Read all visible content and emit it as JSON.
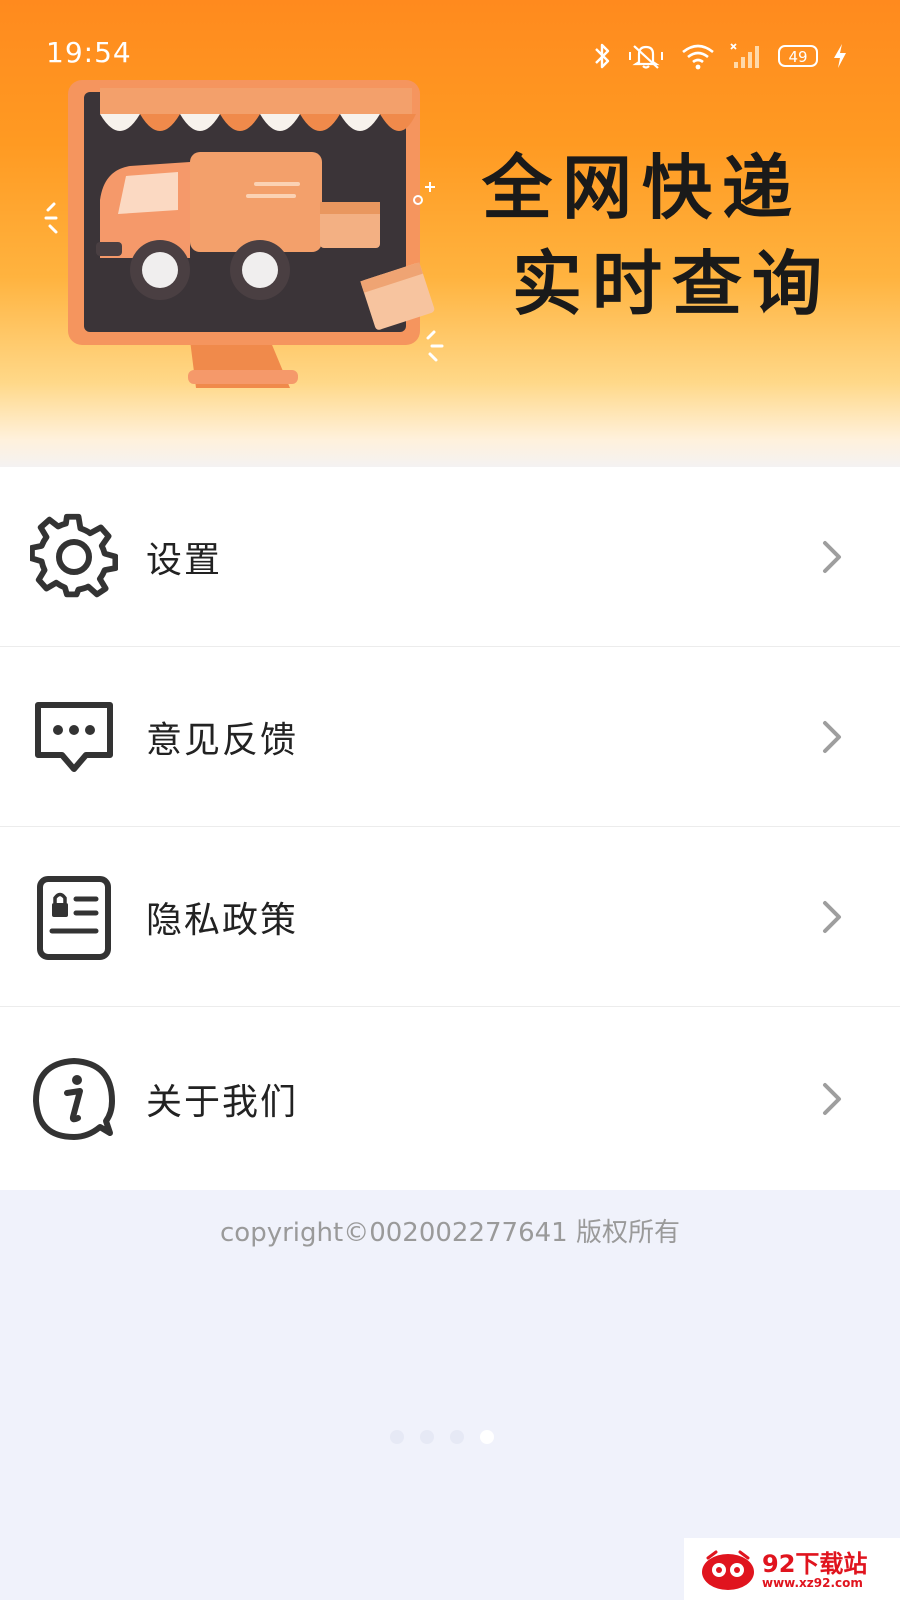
{
  "status_bar": {
    "time": "19:54",
    "battery": "49",
    "icons": [
      "bluetooth-icon",
      "mute-icon",
      "wifi-icon",
      "signal-icon",
      "charging-icon"
    ]
  },
  "banner": {
    "title_line1": "全网快递",
    "title_line2": "实时查询",
    "illustration": "delivery-truck-shop-illustration"
  },
  "menu": {
    "items": [
      {
        "label": "设置",
        "icon": "gear-icon"
      },
      {
        "label": "意见反馈",
        "icon": "feedback-icon"
      },
      {
        "label": "隐私政策",
        "icon": "privacy-document-icon"
      },
      {
        "label": "关于我们",
        "icon": "info-icon"
      }
    ]
  },
  "footer": {
    "copyright": "copyright©002002277641 版权所有"
  },
  "pager": {
    "count": 4,
    "active": 4
  },
  "watermark": {
    "text": "92下载站",
    "url": "www.xz92.com"
  },
  "colors": {
    "accent": "#ff8a1e",
    "page_bg": "#f0f2fb",
    "text": "#222222",
    "muted": "#9a9a9a"
  }
}
